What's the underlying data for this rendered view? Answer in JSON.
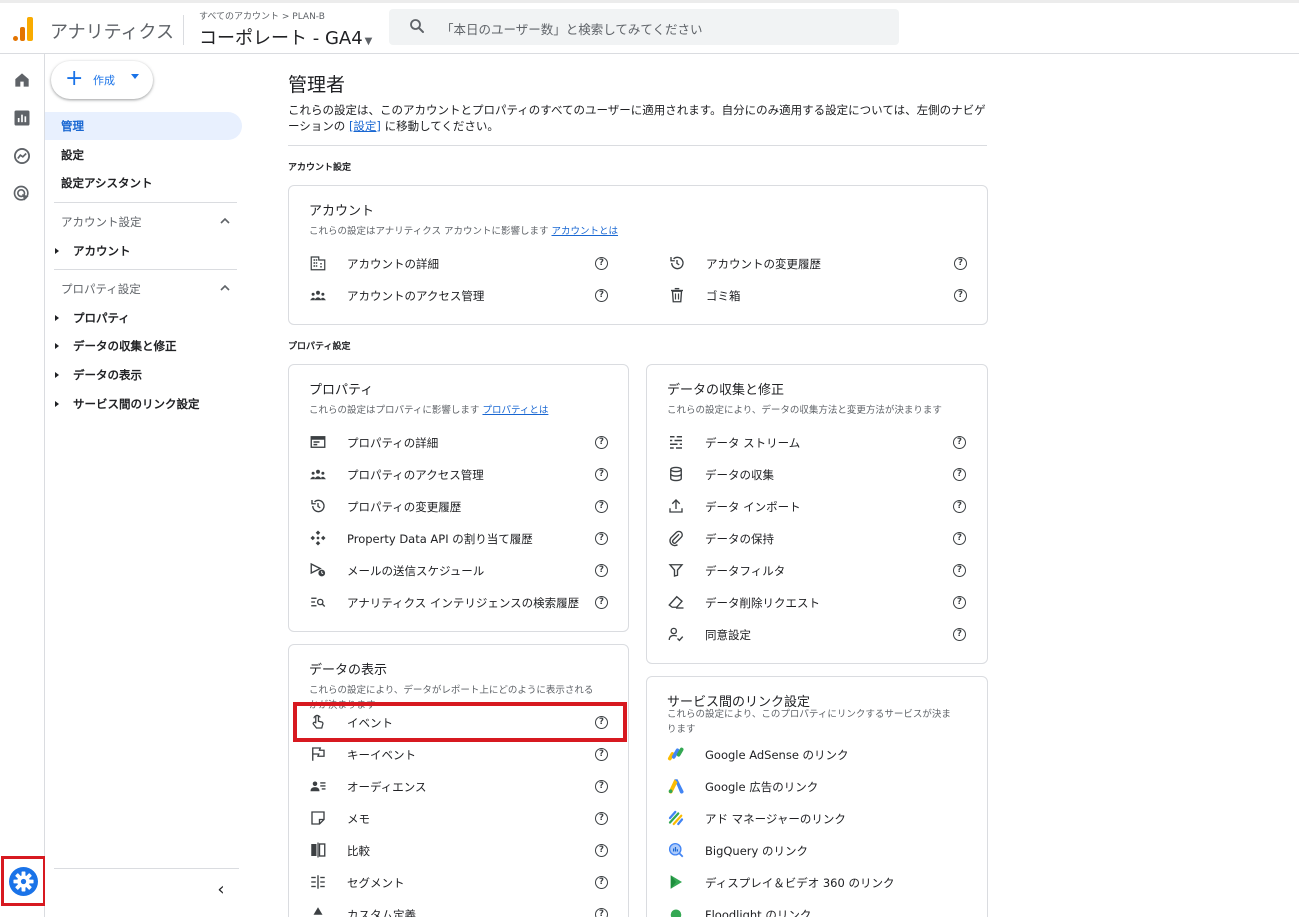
{
  "header": {
    "app_title": "アナリティクス",
    "breadcrumb": "すべてのアカウント > PLAN-B",
    "property": "コーポレート - GA4",
    "search_placeholder": "「本日のユーザー数」と検索してみてください"
  },
  "rail": {
    "icons": [
      "home-icon",
      "reports-icon",
      "explore-icon",
      "advertising-icon"
    ],
    "admin_icon": "gear-icon"
  },
  "nav": {
    "create_label": "作成",
    "items": [
      "管理",
      "設定",
      "設定アシスタント"
    ],
    "account_section": "アカウント設定",
    "account_items": [
      "アカウント"
    ],
    "property_section": "プロパティ設定",
    "property_items": [
      "プロパティ",
      "データの収集と修正",
      "データの表示",
      "サービス間のリンク設定"
    ]
  },
  "main": {
    "title": "管理者",
    "desc_part1": "これらの設定は、このアカウントとプロパティのすべてのユーザーに適用されます。自分にのみ適用する設定については、左側のナビゲーションの ",
    "desc_link": "[設定]",
    "desc_part2": " に移動してください。",
    "account_label": "アカウント設定",
    "property_label": "プロパティ設定"
  },
  "cards": {
    "account": {
      "title": "アカウント",
      "desc": "これらの設定はアナリティクス アカウントに影響します ",
      "link": "アカウントとは",
      "left": [
        "アカウントの詳細",
        "アカウントのアクセス管理"
      ],
      "right": [
        "アカウントの変更履歴",
        "ゴミ箱"
      ]
    },
    "property": {
      "title": "プロパティ",
      "desc": "これらの設定はプロパティに影響します ",
      "link": "プロパティとは",
      "items": [
        "プロパティの詳細",
        "プロパティのアクセス管理",
        "プロパティの変更履歴",
        "Property Data API の割り当て履歴",
        "メールの送信スケジュール",
        "アナリティクス インテリジェンスの検索履歴"
      ]
    },
    "collection": {
      "title": "データの収集と修正",
      "desc": "これらの設定により、データの収集方法と変更方法が決まります",
      "items": [
        "データ ストリーム",
        "データの収集",
        "データ インポート",
        "データの保持",
        "データフィルタ",
        "データ削除リクエスト",
        "同意設定"
      ]
    },
    "display": {
      "title": "データの表示",
      "desc_line1": "これらの設定により、データがレポート上にどのように表示される",
      "desc_line2": "かが決まります",
      "items": [
        "イベント",
        "キーイベント",
        "オーディエンス",
        "メモ",
        "比較",
        "セグメント",
        "カスタム定義"
      ]
    },
    "links": {
      "title": "サービス間のリンク設定",
      "desc_line1": "これらの設定により、このプロパティにリンクするサービスが決ま",
      "desc_line2": "ります",
      "items": [
        "Google AdSense のリンク",
        "Google 広告のリンク",
        "アド マネージャーのリンク",
        "BigQuery のリンク",
        "ディスプレイ＆ビデオ 360 のリンク",
        "Floodlight のリンク"
      ]
    }
  },
  "help_glyph": "?",
  "colors": {
    "accent": "#1a73e8",
    "highlight": "#d71920"
  }
}
